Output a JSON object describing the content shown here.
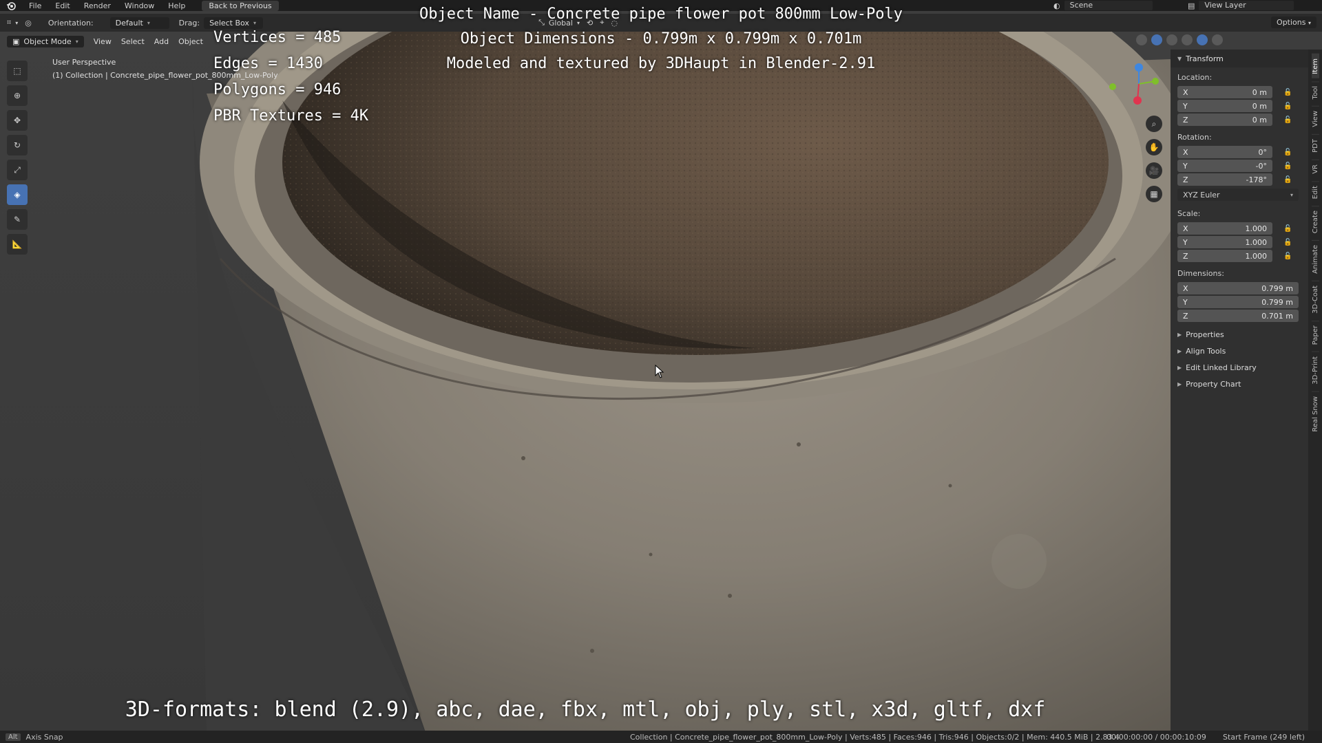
{
  "topbar": {
    "menus": [
      "File",
      "Edit",
      "Render",
      "Window",
      "Help"
    ],
    "back_label": "Back to Previous",
    "scene_label": "Scene",
    "view_layer_label": "View Layer"
  },
  "header": {
    "orientation_label": "Orientation:",
    "orientation_value": "Default",
    "drag_label": "Drag:",
    "drag_value": "Select Box",
    "transform_space": "Global",
    "options_label": "Options"
  },
  "modebar": {
    "mode": "Object Mode",
    "menus": [
      "View",
      "Select",
      "Add",
      "Object"
    ]
  },
  "viewport": {
    "perspective": "User Perspective",
    "collection_info": "(1) Collection | Concrete_pipe_flower_pot_800mm_Low-Poly"
  },
  "overlay": {
    "object_name": "Object Name - Concrete pipe flower pot 800mm Low-Poly",
    "dimensions": "Object Dimensions -  0.799m x 0.799m x 0.701m",
    "credit": "Modeled and textured by 3DHaupt in Blender-2.91",
    "vertices": "Vertices = 485",
    "edges": "Edges = 1430",
    "polygons": "Polygons = 946",
    "textures": "PBR Textures = 4K",
    "formats": "3D-formats: blend (2.9), abc, dae, fbx, mtl, obj, ply, stl, x3d, gltf, dxf"
  },
  "npanel": {
    "transform_title": "Transform",
    "location_label": "Location:",
    "location": [
      {
        "axis": "X",
        "value": "0 m"
      },
      {
        "axis": "Y",
        "value": "0 m"
      },
      {
        "axis": "Z",
        "value": "0 m"
      }
    ],
    "rotation_label": "Rotation:",
    "rotation": [
      {
        "axis": "X",
        "value": "0°"
      },
      {
        "axis": "Y",
        "value": "-0°"
      },
      {
        "axis": "Z",
        "value": "-178°"
      }
    ],
    "rotation_mode": "XYZ Euler",
    "scale_label": "Scale:",
    "scale": [
      {
        "axis": "X",
        "value": "1.000"
      },
      {
        "axis": "Y",
        "value": "1.000"
      },
      {
        "axis": "Z",
        "value": "1.000"
      }
    ],
    "dimensions_label": "Dimensions:",
    "dimensions": [
      {
        "axis": "X",
        "value": "0.799 m"
      },
      {
        "axis": "Y",
        "value": "0.799 m"
      },
      {
        "axis": "Z",
        "value": "0.701 m"
      }
    ],
    "sections": [
      "Properties",
      "Align Tools",
      "Edit Linked Library",
      "Property Chart"
    ]
  },
  "sidetabs": [
    "Item",
    "Tool",
    "View",
    "PDT",
    "VR",
    "Edit",
    "Create",
    "Animate",
    "3D-Coat",
    "Paper",
    "3D-Print",
    "Real Snow"
  ],
  "statusbar": {
    "alt_key": "Alt",
    "axis_snap": "Axis Snap",
    "info": "Collection | Concrete_pipe_flower_pot_800mm_Low-Poly | Verts:485 | Faces:946 | Tris:946 | Objects:0/2 | Mem: 440.5 MiB | 2.83.4",
    "time": "00:00:00:00 / 00:00:10:09",
    "frame": "Start Frame (249 left)"
  },
  "colors": {
    "accent": "#4772b3",
    "pot_base": "#8a8377",
    "soil": "#5a4a3c",
    "gizmo_x": "#e0344f",
    "gizmo_y": "#7fbf2a",
    "gizmo_z": "#3f87e0"
  }
}
